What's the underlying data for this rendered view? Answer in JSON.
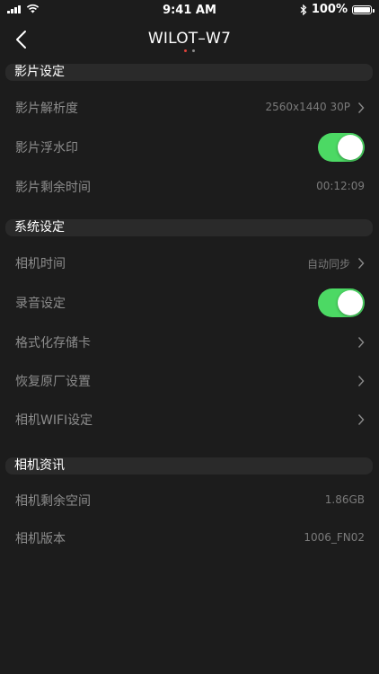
{
  "status_bar": {
    "time": "9:41 AM",
    "battery_percent": "100%",
    "battery_level": 1.0
  },
  "nav": {
    "title": "WILOT–W7",
    "page_dots": [
      {
        "color": "#e0413a"
      },
      {
        "color": "#8e8e8e"
      }
    ]
  },
  "sections": {
    "video": {
      "header": "影片设定",
      "resolution": {
        "label": "影片解析度",
        "value": "2560x1440 30P"
      },
      "watermark": {
        "label": "影片浮水印",
        "on": true
      },
      "remaining_time": {
        "label": "影片剩余时间",
        "value": "00:12:09"
      }
    },
    "system": {
      "header": "系统设定",
      "camera_time": {
        "label": "相机时间",
        "value": "自动同步"
      },
      "audio": {
        "label": "录音设定",
        "on": true
      },
      "format": {
        "label": "格式化存储卡"
      },
      "factory_reset": {
        "label": "恢复原厂设置"
      },
      "wifi": {
        "label": "相机WIFI设定"
      }
    },
    "info": {
      "header": "相机资讯",
      "free_space": {
        "label": "相机剩余空间",
        "value": "1.86GB"
      },
      "version": {
        "label": "相机版本",
        "value": "1006_FN02"
      }
    }
  },
  "colors": {
    "background": "#1c1c1c",
    "section_bg": "#2a2a2a",
    "toggle_on": "#4cd964",
    "label": "#8c8c8c"
  }
}
